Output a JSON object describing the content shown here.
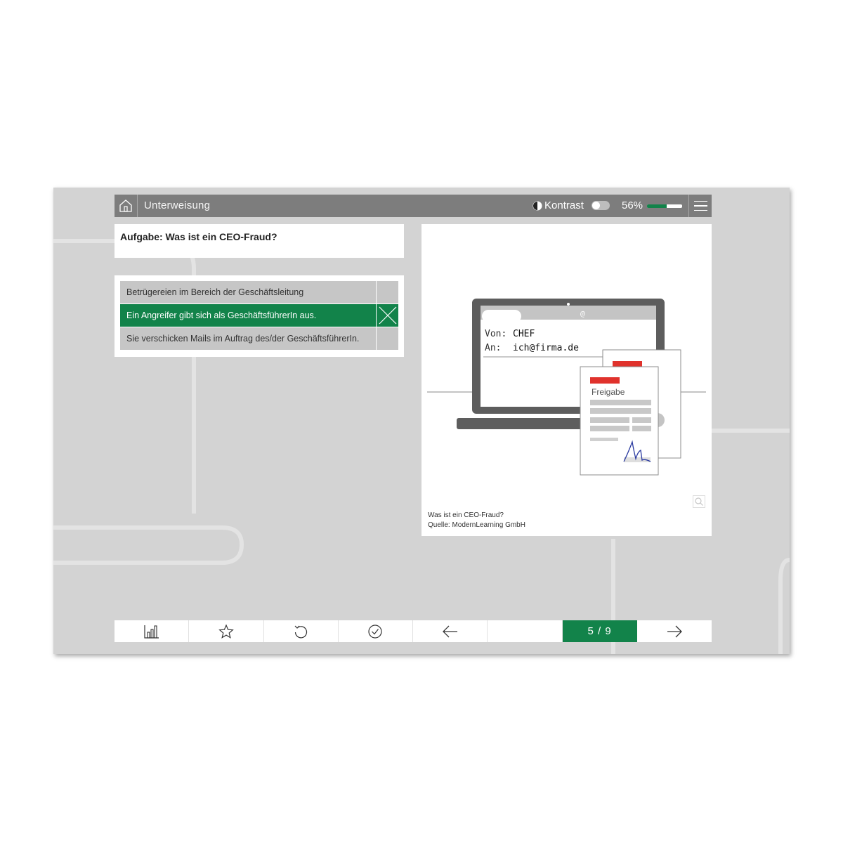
{
  "header": {
    "title": "Unterweisung",
    "contrast_label": "Kontrast",
    "progress_text": "56%",
    "progress_fraction": 0.56,
    "icons": [
      "home-icon",
      "contrast-icon",
      "menu-icon"
    ]
  },
  "task": {
    "title": "Aufgabe: Was ist ein CEO-Fraud?"
  },
  "answers": [
    {
      "label": "Betrügereien im Bereich der Geschäftsleitung",
      "selected": false
    },
    {
      "label": "Ein Angreifer gibt sich als GeschäftsführerIn aus.",
      "selected": true
    },
    {
      "label": "Sie verschicken Mails im Auftrag des/der GeschäftsführerIn.",
      "selected": false
    }
  ],
  "media": {
    "email_from_label": "Von:",
    "email_from_value": "CHEF",
    "email_to_label": "An:",
    "email_to_value": "ich@firma.de",
    "at_symbol": "@",
    "doc_label": "Freigabe",
    "caption_line1": "Was ist ein CEO-Fraud?",
    "caption_line2": "Quelle: ModernLearning GmbH"
  },
  "footer": {
    "pager": "5 / 9",
    "icons": [
      "stats-icon",
      "star-icon",
      "reload-icon",
      "check-circle-icon",
      "arrow-left-icon",
      "arrow-right-icon"
    ]
  },
  "colors": {
    "accent": "#12834a",
    "header_bg": "#7d7d7d",
    "frame_bg": "#d3d3d3",
    "doc_red": "#e0322c"
  }
}
